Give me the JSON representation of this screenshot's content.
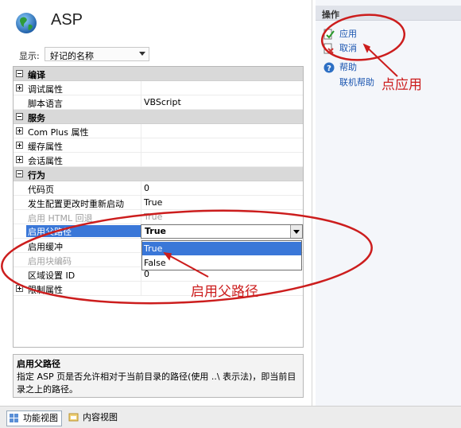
{
  "site": {
    "title": "ASP"
  },
  "toolbar": {
    "show_label": "显示:",
    "show_value": "好记的名称"
  },
  "grid": {
    "rows": [
      {
        "type": "cat",
        "label": "编译",
        "expander": "minus"
      },
      {
        "type": "sub",
        "label": "调试属性",
        "value": "",
        "expander": "plus"
      },
      {
        "type": "item",
        "label": "脚本语言",
        "value": "VBScript"
      },
      {
        "type": "cat",
        "label": "服务",
        "expander": "minus"
      },
      {
        "type": "sub",
        "label": "Com Plus 属性",
        "value": "",
        "expander": "plus"
      },
      {
        "type": "sub",
        "label": "缓存属性",
        "value": "",
        "expander": "plus"
      },
      {
        "type": "sub",
        "label": "会话属性",
        "value": "",
        "expander": "plus"
      },
      {
        "type": "cat",
        "label": "行为",
        "expander": "minus"
      },
      {
        "type": "item",
        "label": "代码页",
        "value": "0"
      },
      {
        "type": "item",
        "label": "发生配置更改时重新启动",
        "value": "True"
      },
      {
        "type": "disabled",
        "label": "启用 HTML 回退",
        "value": "True"
      },
      {
        "type": "selected",
        "label": "启用父路径",
        "value": "True"
      },
      {
        "type": "item",
        "label": "启用缓冲",
        "value": ""
      },
      {
        "type": "disabled",
        "label": "启用块编码",
        "value": ""
      },
      {
        "type": "item",
        "label": "区域设置 ID",
        "value": "0"
      },
      {
        "type": "sub",
        "label": "限制属性",
        "value": "",
        "expander": "plus"
      }
    ]
  },
  "dropdown": {
    "options": [
      "True",
      "False"
    ],
    "active": "True"
  },
  "description": {
    "title": "启用父路径",
    "text": "指定 ASP 页是否允许相对于当前目录的路径(使用 ..\\ 表示法)，即当前目录之上的路径。"
  },
  "bottom_tabs": {
    "features": "功能视图",
    "content": "内容视图"
  },
  "actions": {
    "title": "操作",
    "apply": "应用",
    "cancel": "取消",
    "help": "帮助",
    "online_help": "联机帮助"
  },
  "annotations": {
    "apply_note": "点应用",
    "parent_path_note": "启用父路径"
  },
  "colors": {
    "selection": "#3a77d8",
    "annotation": "#cc1d1d",
    "link": "#1a55b0"
  }
}
